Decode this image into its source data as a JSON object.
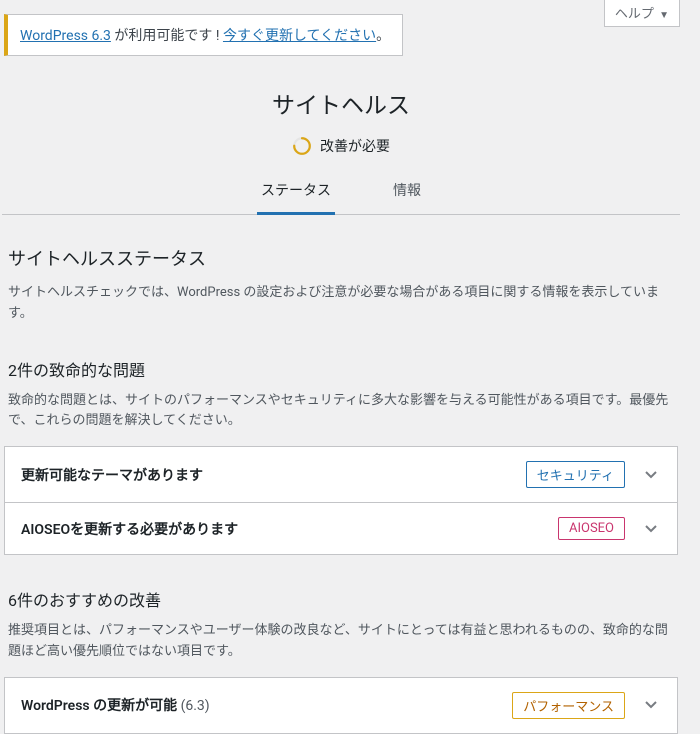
{
  "help_tab": {
    "label": "ヘルプ"
  },
  "update_nag": {
    "prefix": "WordPress 6.3",
    "mid": " が利用可能です ! ",
    "link": "今すぐ更新してください",
    "suffix": "。"
  },
  "header": {
    "title": "サイトヘルス",
    "progress_label": "改善が必要"
  },
  "tabs": {
    "status": "ステータス",
    "info": "情報"
  },
  "status_section": {
    "heading": "サイトヘルスステータス",
    "desc": "サイトヘルスチェックでは、WordPress の設定および注意が必要な場合がある項目に関する情報を表示しています。"
  },
  "critical": {
    "heading": "2件の致命的な問題",
    "desc": "致命的な問題とは、サイトのパフォーマンスやセキュリティに多大な影響を与える可能性がある項目です。最優先で、これらの問題を解決してください。",
    "items": [
      {
        "title": "更新可能なテーマがあります",
        "badge": "セキュリティ",
        "badge_class": "badge-blue"
      },
      {
        "title": "AIOSEOを更新する必要があります",
        "badge": "AIOSEO",
        "badge_class": "badge-red"
      }
    ]
  },
  "recommended": {
    "heading": "6件のおすすめの改善",
    "desc": "推奨項目とは、パフォーマンスやユーザー体験の改良など、サイトにとっては有益と思われるものの、致命的な問題ほど高い優先順位ではない項目です。",
    "items": [
      {
        "title": "WordPress の更新が可能",
        "version": "(6.3)",
        "badge": "パフォーマンス",
        "badge_class": "badge-orange"
      }
    ]
  }
}
